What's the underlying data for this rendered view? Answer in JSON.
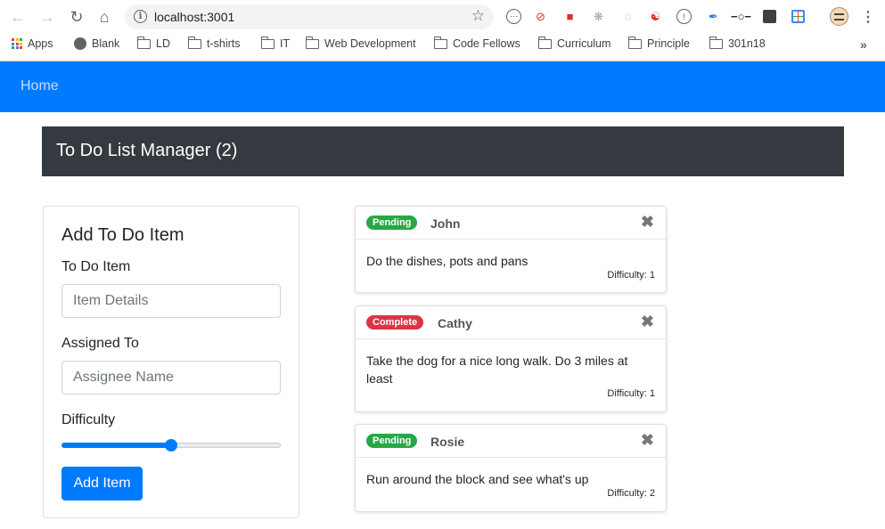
{
  "browser": {
    "url": "localhost:3001",
    "bookmarks": [
      "Apps",
      "Blank",
      "LD",
      "t-shirts",
      "IT",
      "Web Development",
      "Code Fellows",
      "Curriculum",
      "Principle",
      "301n18"
    ]
  },
  "navbar": {
    "home_label": "Home"
  },
  "header": {
    "title": "To Do List Manager (2)"
  },
  "form": {
    "title": "Add To Do Item",
    "item_label": "To Do Item",
    "item_placeholder": "Item Details",
    "assignee_label": "Assigned To",
    "assignee_placeholder": "Assignee Name",
    "difficulty_label": "Difficulty",
    "difficulty_value": 0.5,
    "submit_label": "Add Item"
  },
  "todos": [
    {
      "status": "Pending",
      "status_color": "#28a745",
      "assignee": "John",
      "text": "Do the dishes, pots and pans",
      "difficulty": "Difficulty: 1"
    },
    {
      "status": "Complete",
      "status_color": "#dc3545",
      "assignee": "Cathy",
      "text": "Take the dog for a nice long walk. Do 3 miles at least",
      "difficulty": "Difficulty: 1"
    },
    {
      "status": "Pending",
      "status_color": "#28a745",
      "assignee": "Rosie",
      "text": "Run around the block and see what's up",
      "difficulty": "Difficulty: 2"
    }
  ],
  "colors": {
    "primary": "#007bff",
    "dark": "#343a40",
    "pending": "#28a745",
    "complete": "#dc3545"
  }
}
